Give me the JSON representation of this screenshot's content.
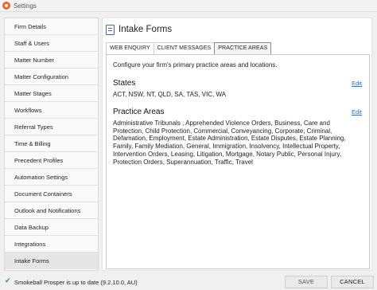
{
  "window": {
    "title": "Settings",
    "icon": "smokeball-logo-icon"
  },
  "sidebar": {
    "items": [
      {
        "label": "Firm Details",
        "active": false
      },
      {
        "label": "Staff & Users",
        "active": false
      },
      {
        "label": "Matter Number",
        "active": false
      },
      {
        "label": "Matter Configuration",
        "active": false
      },
      {
        "label": "Matter Stages",
        "active": false
      },
      {
        "label": "Workflows",
        "active": false
      },
      {
        "label": "Referral Types",
        "active": false
      },
      {
        "label": "Time & Billing",
        "active": false
      },
      {
        "label": "Precedent Profiles",
        "active": false
      },
      {
        "label": "Automation Settings",
        "active": false
      },
      {
        "label": "Document Containers",
        "active": false
      },
      {
        "label": "Outlook and Notifications",
        "active": false
      },
      {
        "label": "Data Backup",
        "active": false
      },
      {
        "label": "Integrations",
        "active": false
      },
      {
        "label": "Intake Forms",
        "active": true
      }
    ]
  },
  "main": {
    "title": "Intake Forms",
    "tabs": [
      {
        "label": "WEB ENQUIRY",
        "active": false
      },
      {
        "label": "CLIENT MESSAGES",
        "active": false
      },
      {
        "label": "PRACTICE AREAS",
        "active": true
      }
    ],
    "intro": "Configure your firm's primary practice areas and locations.",
    "states": {
      "title": "States",
      "edit_label": "Edit",
      "value": "ACT, NSW, NT, QLD, SA, TAS, VIC, WA"
    },
    "practice_areas": {
      "title": "Practice Areas",
      "edit_label": "Edit",
      "value": "Administrative Tribunals , Apprehended Violence Orders, Business, Care and Protection, Child Protection, Commercial, Conveyancing, Corporate, Criminal, Defamation, Employment, Estate Administration, Estate Disputes, Estate Planning, Family, Family Mediation, General, Immigration, Insolvency, Intellectual Property, Intervention Orders, Leasing, Litigation, Mortgage, Notary Public, Personal Injury, Protection Orders, Superannuation, Traffic, Travel"
    }
  },
  "status": {
    "text": "Smokeball Prosper is up to date (9.2.10.0, AU)",
    "icon": "checkmark-icon",
    "save_label": "SAVE",
    "cancel_label": "CANCEL"
  },
  "colors": {
    "accent": "#2e6cc7",
    "success": "#2e9e47",
    "brand": "#e8692c"
  }
}
